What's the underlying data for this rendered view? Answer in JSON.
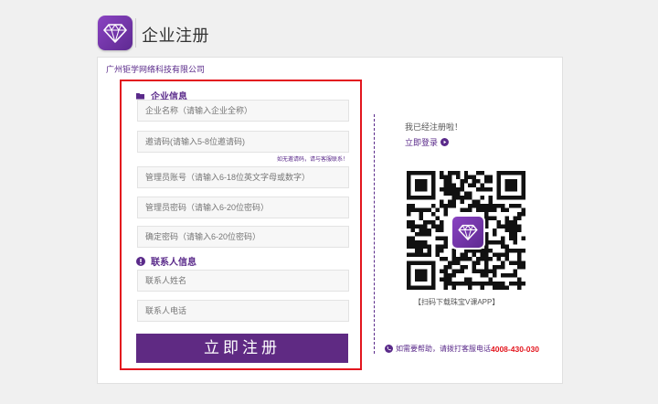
{
  "header": {
    "title": "企业注册",
    "logo_icon": "diamond-icon"
  },
  "company_name": "广州钜学网络科技有限公司",
  "form": {
    "section_company": {
      "title": "企业信息",
      "icon": "folder-icon"
    },
    "fields": {
      "company_name_placeholder": "企业名称（请输入企业全称）",
      "invite_code_placeholder": "邀请码(请输入5-8位邀请码)",
      "admin_account_placeholder": "管理员账号（请输入6-18位英文字母或数字）",
      "admin_password_placeholder": "管理员密码（请输入6-20位密码）",
      "confirm_password_placeholder": "确定密码（请输入6-20位密码）",
      "contact_name_placeholder": "联系人姓名",
      "contact_phone_placeholder": "联系人电话"
    },
    "invite_hint": "如无邀请码，请与客服联系！",
    "section_contact": {
      "title": "联系人信息",
      "icon": "exclamation-circle-icon"
    },
    "submit_label": "立即注册"
  },
  "side": {
    "registered_text": "我已经注册啦！",
    "login_label": "立即登录",
    "login_icon": "play-circle-icon",
    "qr_caption": "【扫码下载珠宝V课APP】",
    "help_text": "如需要帮助，请拨打客服电话",
    "help_phone": "4008-430-030",
    "help_icon": "phone-circle-icon"
  },
  "colors": {
    "brand_purple": "#5f2a83",
    "accent_red": "#e3161e",
    "background": "#f0f0f0"
  }
}
